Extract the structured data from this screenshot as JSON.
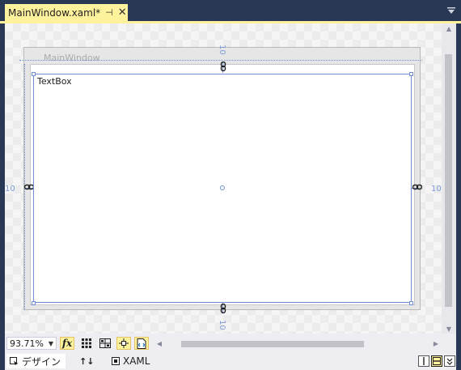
{
  "document_tab": {
    "title": "MainWindow.xaml*",
    "pin_glyph": "⊣",
    "close_glyph": "✕"
  },
  "designer": {
    "window_title": "MainWindow",
    "textbox_text": "TextBox",
    "margins": {
      "top": "10",
      "left": "10",
      "right": "10",
      "bottom": "10"
    }
  },
  "toolbar": {
    "zoom_value": "93.71%",
    "fx_label": "fx"
  },
  "view_tabs": {
    "design_label": "デザイン",
    "swap_glyph": "↑↓",
    "xaml_label": "XAML"
  },
  "colors": {
    "accent": "#fff29d",
    "chrome": "#293955",
    "selection": "#6d8fd0"
  }
}
